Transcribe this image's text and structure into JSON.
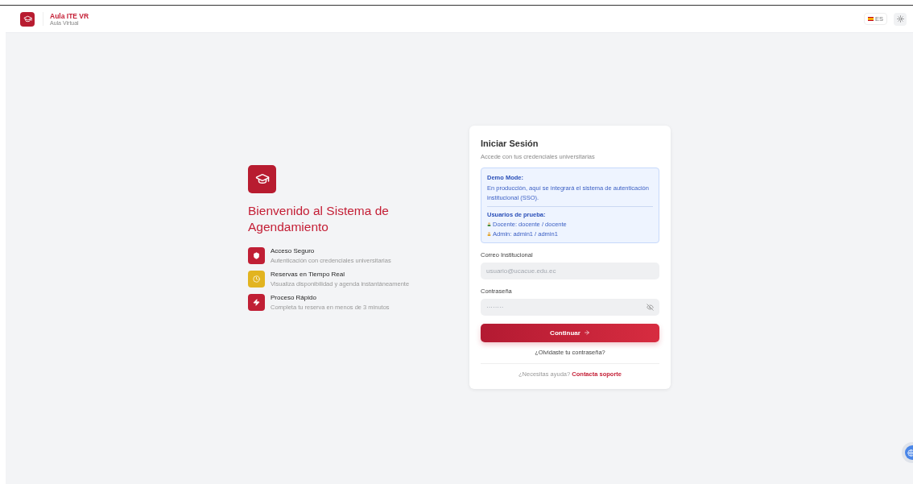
{
  "header": {
    "brand_title": "Aula ITE VR",
    "brand_subtitle": "Aula Virtual",
    "language": "ES"
  },
  "welcome": {
    "title": "Bienvenido al Sistema de Agendamiento",
    "features": [
      {
        "kind": "shield",
        "title": "Acceso Seguro",
        "description": "Autenticación con credenciales universitarias",
        "color": "#c01f35"
      },
      {
        "kind": "clock",
        "title": "Reservas en Tiempo Real",
        "description": "Visualiza disponibilidad y agenda instantáneamente",
        "color": "#e2b420"
      },
      {
        "kind": "bolt",
        "title": "Proceso Rápido",
        "description": "Completa tu reserva en menos de 3 minutos",
        "color": "#c01f35"
      }
    ]
  },
  "login": {
    "title": "Iniciar Sesión",
    "subtitle": "Accede con tus credenciales universitarias",
    "demo": {
      "title": "Demo Mode:",
      "text": "En producción, aquí se integrará el sistema de autenticación institucional (SSO).",
      "users_title": "Usuarios de prueba:",
      "users": [
        {
          "kind": "teacher",
          "text": "Docente: docente / docente"
        },
        {
          "kind": "admin",
          "text": "Admin: admin1 / admin1"
        }
      ]
    },
    "email": {
      "label": "Correo Institucional",
      "placeholder": "usuario@ucacue.edu.ec"
    },
    "password": {
      "label": "Contraseña",
      "placeholder": "········"
    },
    "submit": "Continuar",
    "forgot": "¿Olvidaste tu contraseña?",
    "help": "¿Necesitas ayuda?",
    "support": "Contacta soporte"
  }
}
